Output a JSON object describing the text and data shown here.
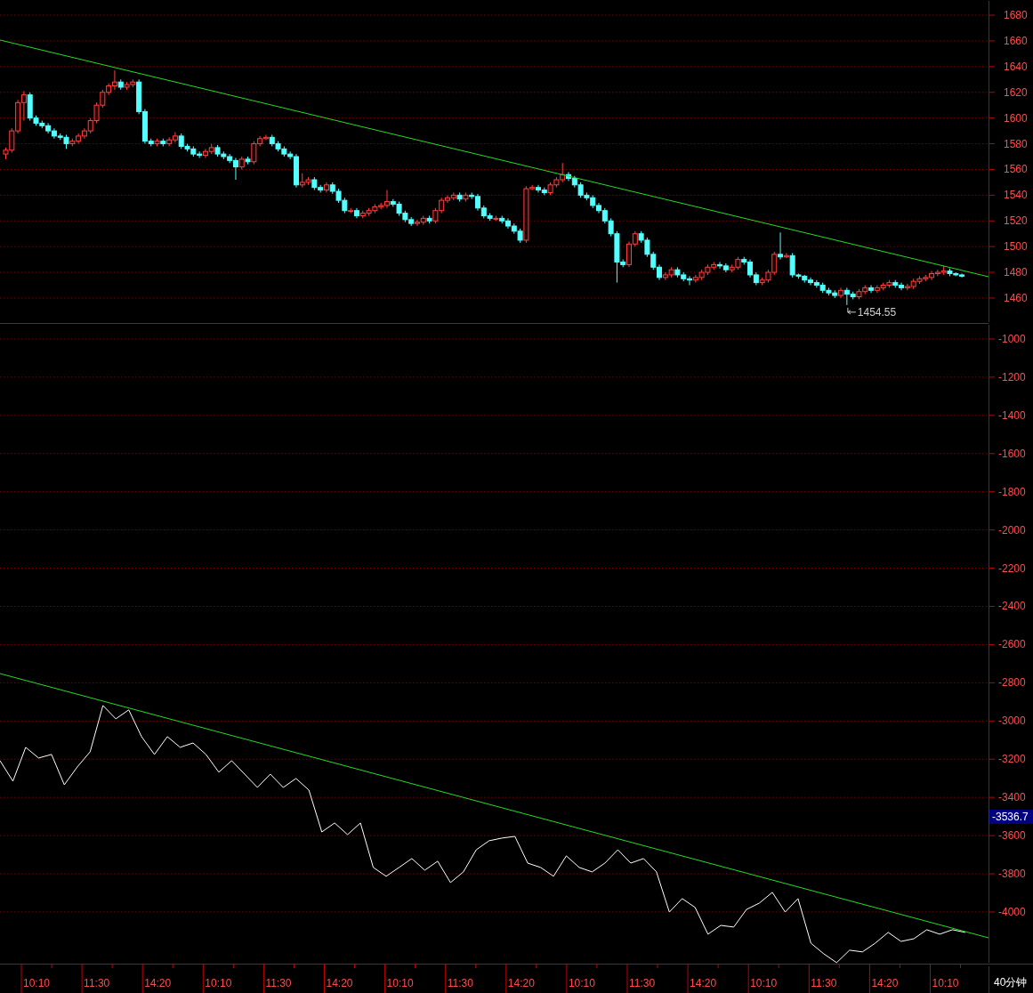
{
  "price_panel": {
    "chart_data": {
      "type": "candlestick",
      "grid": true,
      "ylim": [
        1439.9,
        1691.8
      ],
      "yticks": [
        1680,
        1660,
        1640,
        1620,
        1600,
        1580,
        1560,
        1540,
        1520,
        1500,
        1480,
        1460
      ],
      "categories": [
        null,
        null,
        null,
        null,
        null,
        null,
        null,
        null,
        null,
        null,
        null,
        null,
        null,
        null,
        null,
        null,
        null,
        null,
        null,
        null,
        null,
        null,
        null,
        null,
        null,
        null,
        null,
        null,
        null,
        null,
        null,
        null,
        null,
        null,
        null,
        null,
        null,
        null,
        null,
        null,
        null,
        null,
        null,
        null,
        null,
        null,
        null,
        null,
        null,
        null,
        null,
        null,
        null,
        null,
        null,
        null,
        null,
        null,
        null,
        null,
        null,
        null,
        null,
        null,
        null,
        null,
        null,
        null,
        null,
        null,
        null,
        null,
        null,
        null,
        null,
        null,
        null,
        null,
        null,
        null,
        null,
        null,
        null,
        null,
        null,
        null,
        null,
        null,
        null,
        null,
        null,
        null,
        null,
        null,
        null,
        null,
        null,
        null,
        null,
        null,
        null,
        null,
        null,
        null,
        null,
        null,
        null,
        null,
        null,
        null,
        null,
        null,
        null,
        null,
        null,
        null,
        null,
        null,
        null,
        null,
        null,
        null,
        null,
        null,
        null,
        null,
        null,
        null,
        null,
        null,
        null,
        null,
        null,
        null,
        null,
        null,
        null,
        null,
        null,
        null,
        null,
        null,
        null,
        null,
        null,
        null,
        null,
        null,
        null,
        null,
        null,
        null,
        null,
        null,
        null,
        null,
        null,
        null,
        null
      ],
      "ohlc": [
        [
          1572,
          1577,
          1568,
          1575
        ],
        [
          1575,
          1592,
          1573,
          1590
        ],
        [
          1590,
          1614,
          1588,
          1612
        ],
        [
          1612,
          1621,
          1598,
          1618
        ],
        [
          1618,
          1620,
          1598,
          1600
        ],
        [
          1600,
          1602,
          1594,
          1596
        ],
        [
          1596,
          1598,
          1592,
          1594
        ],
        [
          1594,
          1596,
          1588,
          1590
        ],
        [
          1590,
          1592,
          1584,
          1586
        ],
        [
          1586,
          1588,
          1583,
          1585
        ],
        [
          1585,
          1587,
          1576,
          1580
        ],
        [
          1580,
          1584,
          1578,
          1582
        ],
        [
          1582,
          1588,
          1580,
          1586
        ],
        [
          1586,
          1592,
          1584,
          1590
        ],
        [
          1590,
          1600,
          1588,
          1598
        ],
        [
          1598,
          1612,
          1596,
          1610
        ],
        [
          1610,
          1622,
          1608,
          1620
        ],
        [
          1620,
          1627,
          1618,
          1625
        ],
        [
          1625,
          1637,
          1622,
          1628
        ],
        [
          1628,
          1630,
          1622,
          1624
        ],
        [
          1624,
          1628,
          1622,
          1626
        ],
        [
          1626,
          1630,
          1624,
          1628
        ],
        [
          1628,
          1630,
          1603,
          1605
        ],
        [
          1605,
          1607,
          1580,
          1582
        ],
        [
          1582,
          1584,
          1578,
          1580
        ],
        [
          1580,
          1584,
          1578,
          1582
        ],
        [
          1582,
          1584,
          1578,
          1580
        ],
        [
          1580,
          1585,
          1578,
          1583
        ],
        [
          1583,
          1589,
          1581,
          1586
        ],
        [
          1586,
          1588,
          1576,
          1578
        ],
        [
          1578,
          1580,
          1574,
          1576
        ],
        [
          1576,
          1578,
          1570,
          1572
        ],
        [
          1572,
          1574,
          1569,
          1571
        ],
        [
          1571,
          1576,
          1569,
          1574
        ],
        [
          1574,
          1580,
          1572,
          1577
        ],
        [
          1577,
          1579,
          1570,
          1572
        ],
        [
          1572,
          1574,
          1568,
          1570
        ],
        [
          1570,
          1572,
          1565,
          1567
        ],
        [
          1567,
          1569,
          1552,
          1562
        ],
        [
          1562,
          1570,
          1560,
          1568
        ],
        [
          1568,
          1570,
          1564,
          1566
        ],
        [
          1566,
          1582,
          1564,
          1580
        ],
        [
          1580,
          1586,
          1578,
          1584
        ],
        [
          1584,
          1587,
          1583,
          1585
        ],
        [
          1585,
          1587,
          1578,
          1580
        ],
        [
          1580,
          1582,
          1574,
          1576
        ],
        [
          1576,
          1578,
          1570,
          1572
        ],
        [
          1572,
          1574,
          1568,
          1570
        ],
        [
          1570,
          1572,
          1546,
          1548
        ],
        [
          1548,
          1557,
          1546,
          1550
        ],
        [
          1550,
          1554,
          1548,
          1552
        ],
        [
          1552,
          1554,
          1544,
          1546
        ],
        [
          1546,
          1548,
          1542,
          1544
        ],
        [
          1544,
          1550,
          1542,
          1548
        ],
        [
          1548,
          1550,
          1541,
          1543
        ],
        [
          1543,
          1545,
          1534,
          1536
        ],
        [
          1536,
          1538,
          1526,
          1528
        ],
        [
          1528,
          1530,
          1526,
          1528
        ],
        [
          1528,
          1530,
          1522,
          1524
        ],
        [
          1524,
          1528,
          1522,
          1526
        ],
        [
          1526,
          1530,
          1524,
          1528
        ],
        [
          1528,
          1533,
          1526,
          1531
        ],
        [
          1531,
          1534,
          1529,
          1532
        ],
        [
          1532,
          1544,
          1530,
          1535
        ],
        [
          1535,
          1537,
          1531,
          1533
        ],
        [
          1533,
          1535,
          1524,
          1526
        ],
        [
          1526,
          1528,
          1519,
          1521
        ],
        [
          1521,
          1523,
          1516,
          1518
        ],
        [
          1518,
          1521,
          1516,
          1519
        ],
        [
          1519,
          1524,
          1517,
          1522
        ],
        [
          1522,
          1524,
          1518,
          1520
        ],
        [
          1520,
          1530,
          1518,
          1528
        ],
        [
          1528,
          1538,
          1526,
          1536
        ],
        [
          1536,
          1540,
          1534,
          1538
        ],
        [
          1538,
          1542,
          1536,
          1540
        ],
        [
          1540,
          1542,
          1535,
          1537
        ],
        [
          1537,
          1542,
          1535,
          1540
        ],
        [
          1540,
          1542,
          1537,
          1539
        ],
        [
          1539,
          1541,
          1528,
          1530
        ],
        [
          1530,
          1532,
          1522,
          1524
        ],
        [
          1524,
          1526,
          1520,
          1522
        ],
        [
          1522,
          1524,
          1520,
          1522
        ],
        [
          1522,
          1524,
          1518,
          1520
        ],
        [
          1520,
          1522,
          1514,
          1516
        ],
        [
          1516,
          1518,
          1510,
          1512
        ],
        [
          1512,
          1514,
          1503,
          1505
        ],
        [
          1505,
          1547,
          1503,
          1545
        ],
        [
          1545,
          1548,
          1544,
          1546
        ],
        [
          1546,
          1548,
          1542,
          1544
        ],
        [
          1544,
          1546,
          1540,
          1542
        ],
        [
          1542,
          1550,
          1540,
          1548
        ],
        [
          1548,
          1554,
          1546,
          1552
        ],
        [
          1552,
          1565,
          1550,
          1556
        ],
        [
          1556,
          1558,
          1551,
          1553
        ],
        [
          1553,
          1555,
          1546,
          1548
        ],
        [
          1548,
          1550,
          1538,
          1540
        ],
        [
          1540,
          1542,
          1536,
          1538
        ],
        [
          1538,
          1540,
          1530,
          1532
        ],
        [
          1532,
          1534,
          1526,
          1528
        ],
        [
          1528,
          1530,
          1518,
          1520
        ],
        [
          1520,
          1522,
          1508,
          1510
        ],
        [
          1510,
          1512,
          1472,
          1488
        ],
        [
          1488,
          1490,
          1484,
          1486
        ],
        [
          1486,
          1504,
          1484,
          1502
        ],
        [
          1502,
          1512,
          1500,
          1510
        ],
        [
          1510,
          1512,
          1503,
          1505
        ],
        [
          1505,
          1507,
          1492,
          1494
        ],
        [
          1494,
          1496,
          1482,
          1484
        ],
        [
          1484,
          1486,
          1474,
          1476
        ],
        [
          1476,
          1480,
          1474,
          1478
        ],
        [
          1478,
          1484,
          1476,
          1482
        ],
        [
          1482,
          1484,
          1476,
          1478
        ],
        [
          1478,
          1480,
          1473,
          1475
        ],
        [
          1475,
          1477,
          1470,
          1474
        ],
        [
          1474,
          1478,
          1472,
          1476
        ],
        [
          1476,
          1482,
          1474,
          1480
        ],
        [
          1480,
          1486,
          1478,
          1484
        ],
        [
          1484,
          1488,
          1482,
          1486
        ],
        [
          1486,
          1488,
          1483,
          1485
        ],
        [
          1485,
          1487,
          1480,
          1482
        ],
        [
          1482,
          1486,
          1480,
          1484
        ],
        [
          1484,
          1492,
          1482,
          1490
        ],
        [
          1490,
          1492,
          1486,
          1488
        ],
        [
          1488,
          1490,
          1476,
          1478
        ],
        [
          1478,
          1480,
          1470,
          1472
        ],
        [
          1472,
          1476,
          1470,
          1474
        ],
        [
          1474,
          1482,
          1472,
          1480
        ],
        [
          1480,
          1496,
          1478,
          1494
        ],
        [
          1494,
          1511,
          1490,
          1492
        ],
        [
          1492,
          1495,
          1491,
          1493
        ],
        [
          1493,
          1495,
          1476,
          1478
        ],
        [
          1478,
          1479,
          1475,
          1477
        ],
        [
          1477,
          1478,
          1472,
          1474
        ],
        [
          1474,
          1476,
          1470,
          1472
        ],
        [
          1472,
          1474,
          1468,
          1470
        ],
        [
          1470,
          1472,
          1464,
          1466
        ],
        [
          1466,
          1468,
          1462,
          1464
        ],
        [
          1464,
          1466,
          1460,
          1462
        ],
        [
          1462,
          1468,
          1460,
          1466
        ],
        [
          1466,
          1468,
          1454.55,
          1463
        ],
        [
          1463,
          1465,
          1459,
          1461
        ],
        [
          1461,
          1467,
          1459,
          1465
        ],
        [
          1465,
          1470,
          1463,
          1468
        ],
        [
          1468,
          1470,
          1464,
          1466
        ],
        [
          1466,
          1470,
          1464,
          1468
        ],
        [
          1468,
          1472,
          1466,
          1470
        ],
        [
          1470,
          1474,
          1468,
          1472
        ],
        [
          1472,
          1474,
          1468,
          1470
        ],
        [
          1470,
          1472,
          1466,
          1468
        ],
        [
          1468,
          1471,
          1466,
          1469
        ],
        [
          1469,
          1475,
          1467,
          1473
        ],
        [
          1473,
          1477,
          1471,
          1475
        ],
        [
          1475,
          1478,
          1473,
          1476
        ],
        [
          1476,
          1481,
          1474,
          1479
        ],
        [
          1479,
          1482,
          1477,
          1480
        ],
        [
          1480,
          1485,
          1478,
          1481
        ],
        [
          1481,
          1483,
          1477,
          1479
        ],
        [
          1479,
          1480,
          1477,
          1478
        ],
        [
          1478,
          1479,
          1476,
          1477
        ]
      ],
      "annotations": [
        "1454.55"
      ]
    }
  },
  "indicator_panel": {
    "current_value": "-3536.7",
    "chart_data": {
      "type": "line",
      "grid": true,
      "ylim": [
        -4275,
        -921
      ],
      "yticks": [
        -1000,
        -1200,
        -1400,
        -1600,
        -1800,
        -2000,
        -2200,
        -2400,
        -2600,
        -2800,
        -3000,
        -3200,
        -3400,
        -3600,
        -3800,
        -4000
      ],
      "series": [
        {
          "color": "#ffffff",
          "values": [
            -3208,
            -3315,
            -3138,
            -3194,
            -3175,
            -3334,
            -3241,
            -3161,
            -2919,
            -2989,
            -2942,
            -3082,
            -3175,
            -3082,
            -3138,
            -3115,
            -3175,
            -3268,
            -3208,
            -3278,
            -3348,
            -3278,
            -3348,
            -3301,
            -3362,
            -3581,
            -3534,
            -3595,
            -3534,
            -3767,
            -3813,
            -3767,
            -3720,
            -3781,
            -3734,
            -3846,
            -3790,
            -3674,
            -3627,
            -3613,
            -3604,
            -3744,
            -3767,
            -3813,
            -3706,
            -3767,
            -3790,
            -3744,
            -3674,
            -3744,
            -3720,
            -3790,
            -4000,
            -3930,
            -3976,
            -4116,
            -4070,
            -4079,
            -3986,
            -3953,
            -3897,
            -4000,
            -3930,
            -4163,
            -4219,
            -4265,
            -4200,
            -4209,
            -4163,
            -4107,
            -4154,
            -4140,
            -4093,
            -4116,
            -4093,
            -4107
          ]
        }
      ]
    }
  },
  "time_axis": {
    "labels": [
      "10:10",
      "11:30",
      "14:20",
      "10:10",
      "11:30",
      "14:20",
      "10:10",
      "11:30",
      "14:20",
      "10:10",
      "11:30",
      "14:20",
      "10:10",
      "11:30",
      "14:20",
      "10:10"
    ]
  },
  "period_button": "40分钟"
}
